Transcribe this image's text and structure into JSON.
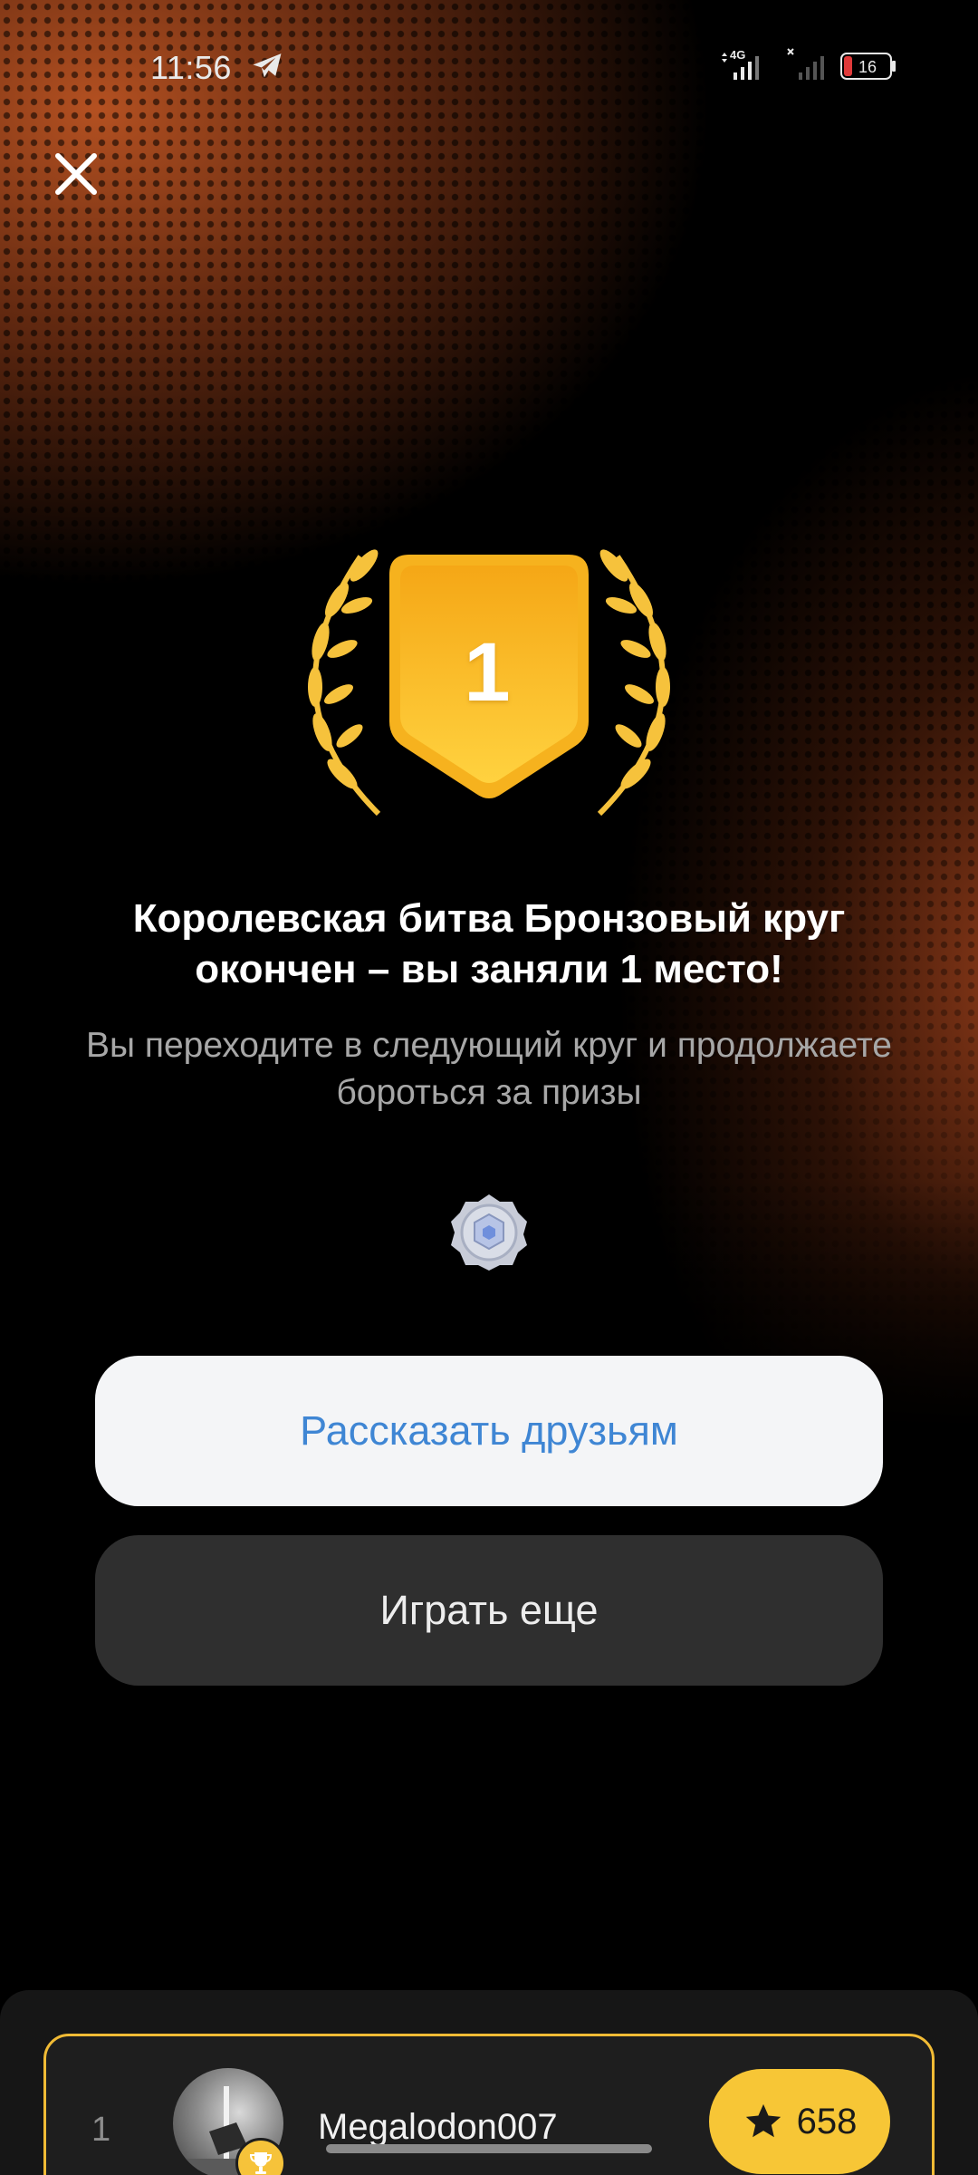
{
  "status_bar": {
    "time": "11:56",
    "network": "4G",
    "battery_level": "16",
    "icons": [
      "telegram-icon",
      "signal-4g-icon",
      "signal-nosim-icon",
      "battery-icon"
    ]
  },
  "close_icon": "close-icon",
  "medal": {
    "place_number": "1",
    "icons": [
      "laurel-left-icon",
      "shield-medal-icon",
      "laurel-right-icon"
    ],
    "color": "#f7c02a"
  },
  "result": {
    "title": "Королевская битва Бронзовый круг окончен – вы заняли 1 место!",
    "subtitle": "Вы переходите в следующий круг и продолжаете бороться за призы",
    "badge_icon": "silver-league-badge-icon"
  },
  "buttons": {
    "share_label": "Рассказать друзьям",
    "play_again_label": "Играть еще"
  },
  "leaderboard": {
    "rows": [
      {
        "rank": "1",
        "username": "Megalodon007",
        "score": "658",
        "icons": [
          "avatar",
          "trophy-icon",
          "star-icon"
        ]
      }
    ]
  },
  "colors": {
    "accent_gold": "#f7c636",
    "link_blue": "#3f86d4",
    "background_orange": "#b9552a"
  }
}
